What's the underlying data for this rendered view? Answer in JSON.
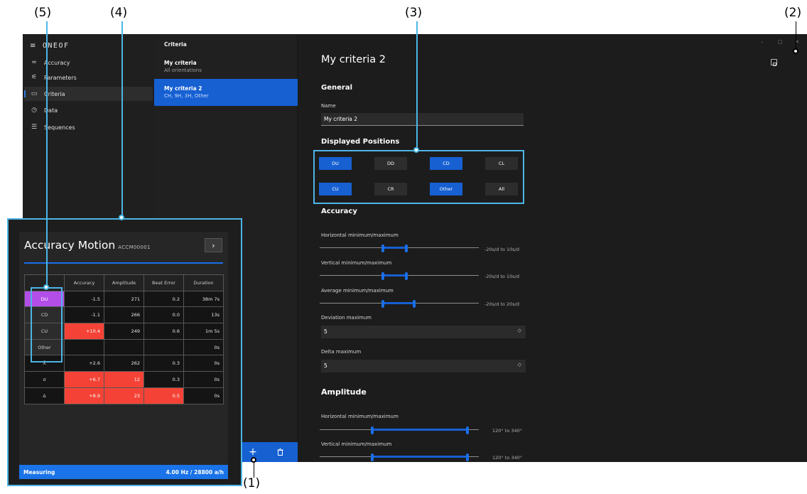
{
  "callouts": {
    "c1": "(1)",
    "c2": "(2)",
    "c3": "(3)",
    "c4": "(4)",
    "c5": "(5)"
  },
  "app": {
    "brand": "ONEOF",
    "nav": [
      {
        "label": "Accuracy",
        "icon": "accuracy-icon"
      },
      {
        "label": "Parameters",
        "icon": "sliders-icon"
      },
      {
        "label": "Criteria",
        "icon": "monitor-icon"
      },
      {
        "label": "Data",
        "icon": "timer-icon"
      },
      {
        "label": "Sequences",
        "icon": "list-icon"
      }
    ],
    "list_header": "Criteria",
    "criteria_list": [
      {
        "name": "My criteria",
        "sub": "All orientations"
      },
      {
        "name": "My criteria 2",
        "sub": "CH, 9H, 3H, Other"
      }
    ],
    "toolbar": {
      "add_icon": "plus-icon",
      "delete_icon": "trash-icon"
    },
    "window_controls": [
      "–",
      "▢",
      "✕"
    ],
    "detail": {
      "title": "My criteria 2",
      "general_heading": "General",
      "name_label": "Name",
      "name_value": "My criteria 2",
      "positions_heading": "Displayed Positions",
      "positions": [
        {
          "label": "DU",
          "selected": true
        },
        {
          "label": "DD",
          "selected": false
        },
        {
          "label": "CD",
          "selected": true
        },
        {
          "label": "CL",
          "selected": false
        },
        {
          "label": "CU",
          "selected": true
        },
        {
          "label": "CR",
          "selected": false
        },
        {
          "label": "Other",
          "selected": true
        },
        {
          "label": "All",
          "selected": false
        }
      ],
      "accuracy_heading": "Accuracy",
      "h_minmax_label": "Horizontal minimum/maximum",
      "h_minmax_range": "-20s/d to 10s/d",
      "v_minmax_label": "Vertical minimum/maximum",
      "v_minmax_range": "-20s/d to 10s/d",
      "avg_minmax_label": "Average minimum/maximum",
      "avg_minmax_range": "-20s/d to 20s/d",
      "deviation_label": "Deviation maximum",
      "deviation_value": "5",
      "delta_label": "Delta maximum",
      "delta_value": "5",
      "amplitude_heading": "Amplitude",
      "amp_h_label": "Horizontal minimum/maximum",
      "amp_h_range": "120° to 340°",
      "amp_v_label": "Vertical minimum/maximum",
      "amp_v_range": "120° to 340°"
    }
  },
  "card": {
    "title": "Accuracy Motion",
    "id": "ACCM00001",
    "next_icon": "chevron-right-icon",
    "columns": [
      "",
      "Accuracy",
      "Amplitude",
      "Beat Error",
      "Duration"
    ],
    "rows": [
      {
        "pos": "DU",
        "cells": [
          "-1.5",
          "271",
          "0.2",
          "38m 7s"
        ],
        "red": []
      },
      {
        "pos": "CD",
        "cells": [
          "-1.1",
          "266",
          "0.0",
          "13s"
        ],
        "red": []
      },
      {
        "pos": "CU",
        "cells": [
          "+10.4",
          "249",
          "0.6",
          "1m 5s"
        ],
        "red": [
          0
        ]
      },
      {
        "pos": "Other",
        "cells": [
          "",
          "",
          "",
          "0s"
        ],
        "red": []
      },
      {
        "pos": "X̄",
        "cells": [
          "+2.6",
          "262",
          "0.3",
          "0s"
        ],
        "red": []
      },
      {
        "pos": "σ",
        "cells": [
          "+6.7",
          "12",
          "0.3",
          "0s"
        ],
        "red": [
          0,
          1
        ]
      },
      {
        "pos": "Δ",
        "cells": [
          "+8.9",
          "23",
          "0.5",
          "0s"
        ],
        "red": [
          0,
          1,
          2
        ]
      }
    ],
    "status_left": "Measuring",
    "status_right": "4.00 Hz / 28800 a/h"
  }
}
